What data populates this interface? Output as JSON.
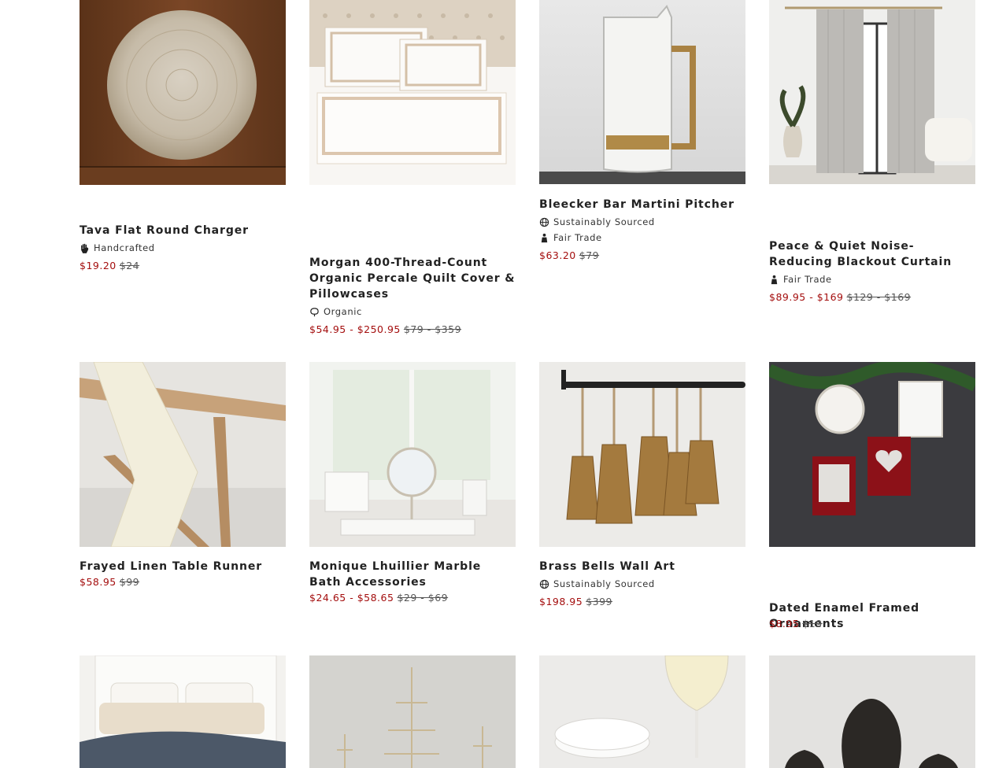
{
  "products": [
    {
      "id": "tava",
      "title": "Tava Flat Round Charger",
      "badges": [
        {
          "icon": "hand-icon",
          "label": "Handcrafted"
        }
      ],
      "sale": "$19.20",
      "orig": "$24"
    },
    {
      "id": "morgan",
      "title": "Morgan 400-Thread-Count Organic Percale Quilt Cover & Pillowcases",
      "badges": [
        {
          "icon": "cotton-icon",
          "label": "Organic"
        }
      ],
      "sale": "$54.95 - $250.95",
      "orig": "$79 - $359"
    },
    {
      "id": "bleecker",
      "title": "Bleecker Bar Martini Pitcher",
      "badges": [
        {
          "icon": "globe-icon",
          "label": "Sustainably Sourced"
        },
        {
          "icon": "fair-trade-icon",
          "label": "Fair Trade"
        }
      ],
      "sale": "$63.20",
      "orig": "$79"
    },
    {
      "id": "peace",
      "title": "Peace & Quiet Noise-Reducing Blackout Curtain",
      "badges": [
        {
          "icon": "fair-trade-icon",
          "label": "Fair Trade"
        }
      ],
      "sale": "$89.95 - $169",
      "orig": "$129 - $169"
    },
    {
      "id": "frayed",
      "title": "Frayed Linen Table Runner",
      "badges": [],
      "sale": "$58.95",
      "orig": "$99"
    },
    {
      "id": "monique",
      "title": "Monique Lhuillier Marble Bath Accessories",
      "badges": [],
      "sale": "$24.65 - $58.65",
      "orig": "$29 - $69"
    },
    {
      "id": "bells",
      "title": "Brass Bells Wall Art",
      "badges": [
        {
          "icon": "globe-icon",
          "label": "Sustainably Sourced"
        }
      ],
      "sale": "$198.95",
      "orig": "$399"
    },
    {
      "id": "dated",
      "title": "Dated Enamel Framed Ornaments",
      "badges": [],
      "sale": "$8.95",
      "orig": "$19"
    }
  ]
}
